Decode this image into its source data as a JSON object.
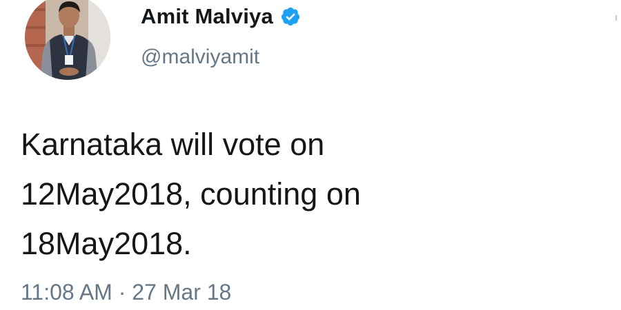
{
  "tweet": {
    "author": {
      "display_name": "Amit Malviya",
      "handle": "@malviyamit",
      "verified": true,
      "avatar_icon": "profile-photo-icon",
      "verified_icon": "verified-badge-icon"
    },
    "text_lines": [
      "Karnataka will vote on",
      "12May2018, counting on",
      "18May2018."
    ],
    "time": "11:08 AM",
    "separator": "·",
    "date": "27 Mar 18"
  },
  "colors": {
    "text_primary": "#14171a",
    "text_secondary": "#657786",
    "verified_blue": "#1da1f2",
    "background": "#ffffff"
  }
}
